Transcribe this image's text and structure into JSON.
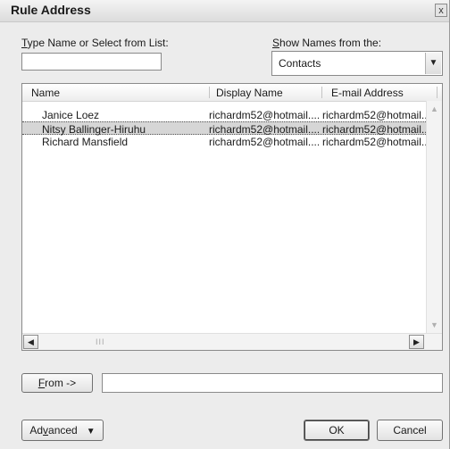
{
  "window": {
    "title": "Rule Address",
    "close_glyph": "x"
  },
  "search": {
    "label": "Type Name or Select from List:",
    "value": ""
  },
  "source": {
    "label": "Show Names from the:",
    "selected": "Contacts",
    "dropdown_icon": "chevron-down-icon"
  },
  "list": {
    "columns": [
      "Name",
      "Display Name",
      "E-mail Address"
    ],
    "rows": [
      {
        "name": "Janice Loez",
        "display": "richardm52@hotmail....",
        "email": "richardm52@hotmail....",
        "selected": false
      },
      {
        "name": "Nitsy Ballinger-Hiruhu",
        "display": "richardm52@hotmail....",
        "email": "richardm52@hotmail....",
        "selected": true
      },
      {
        "name": "Richard Mansfield",
        "display": "richardm52@hotmail....",
        "email": "richardm52@hotmail....",
        "selected": false
      }
    ],
    "hscroll_grip": "III"
  },
  "from": {
    "button_label": "From ->",
    "value": ""
  },
  "footer": {
    "advanced_label": "Advanced",
    "ok_label": "OK",
    "cancel_label": "Cancel"
  }
}
